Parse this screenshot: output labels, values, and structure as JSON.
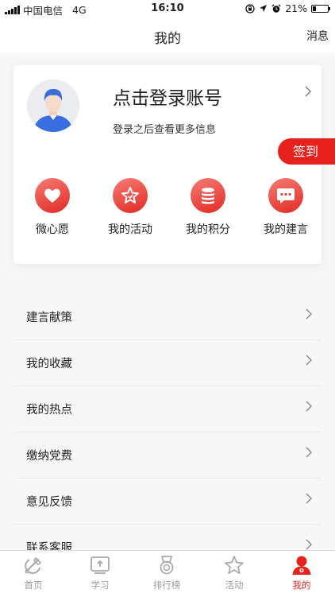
{
  "status_bar": {
    "carrier": "中国电信",
    "network": "4G",
    "time": "16:10",
    "battery": "21%",
    "battery_level": 0.21,
    "icons": [
      "signal-icon",
      "lock-rotation-icon",
      "location-icon",
      "alarm-icon",
      "battery-icon"
    ]
  },
  "nav": {
    "title": "我的",
    "right_action": "消息"
  },
  "profile": {
    "title": "点击登录账号",
    "subtitle": "登录之后查看更多信息",
    "avatar_icon": "user-avatar-icon"
  },
  "checkin_label": "签到",
  "quick_actions": [
    {
      "label": "微心愿",
      "icon": "heart-icon"
    },
    {
      "label": "我的活动",
      "icon": "star-icon"
    },
    {
      "label": "我的积分",
      "icon": "coins-icon"
    },
    {
      "label": "我的建言",
      "icon": "chat-icon"
    }
  ],
  "menu": [
    {
      "label": "建言献策"
    },
    {
      "label": "我的收藏"
    },
    {
      "label": "我的热点"
    },
    {
      "label": "缴纳党费"
    },
    {
      "label": "意见反馈"
    },
    {
      "label": "联系客服"
    }
  ],
  "tabs": [
    {
      "label": "首页",
      "icon": "party-emblem-icon"
    },
    {
      "label": "学习",
      "icon": "learn-icon"
    },
    {
      "label": "排行榜",
      "icon": "medal-icon"
    },
    {
      "label": "活动",
      "icon": "star-outline-icon"
    },
    {
      "label": "我的",
      "icon": "profile-icon",
      "active": true
    }
  ],
  "colors": {
    "accent": "#e6211e",
    "icon_gradient_start": "#f57b74",
    "icon_gradient_end": "#e12b23",
    "tab_inactive": "#9a9a9a",
    "avatar_blue": "#3a6ee0"
  }
}
